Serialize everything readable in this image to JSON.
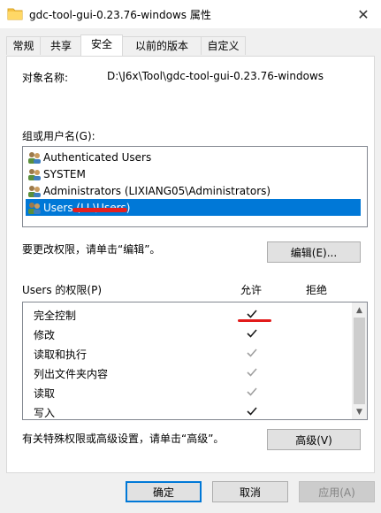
{
  "window": {
    "title": "gdc-tool-gui-0.23.76-windows 属性",
    "close_glyph": "✕"
  },
  "tabs": [
    {
      "label": "常规"
    },
    {
      "label": "共享"
    },
    {
      "label": "安全"
    },
    {
      "label": "以前的版本"
    },
    {
      "label": "自定义"
    }
  ],
  "active_tab": "安全",
  "object": {
    "label": "对象名称:",
    "value": "D:\\J6x\\Tool\\gdc-tool-gui-0.23.76-windows"
  },
  "groups": {
    "label": "组或用户名(G):",
    "items": [
      {
        "text": "Authenticated Users",
        "selected": false
      },
      {
        "text": "SYSTEM",
        "selected": false
      },
      {
        "text": "Administrators (LIXIANG05\\Administrators)",
        "selected": false
      },
      {
        "text": "Users (LI                \\Users)",
        "selected": true
      }
    ]
  },
  "edit": {
    "hint": "要更改权限，请单击“编辑”。",
    "button": "编辑(E)..."
  },
  "permissions": {
    "label": "Users 的权限(P)",
    "allow_header": "允许",
    "deny_header": "拒绝",
    "rows": [
      {
        "name": "完全控制",
        "allow": "dark",
        "deny": "none"
      },
      {
        "name": "修改",
        "allow": "dark",
        "deny": "none"
      },
      {
        "name": "读取和执行",
        "allow": "grey",
        "deny": "none"
      },
      {
        "name": "列出文件夹内容",
        "allow": "grey",
        "deny": "none"
      },
      {
        "name": "读取",
        "allow": "grey",
        "deny": "none"
      },
      {
        "name": "写入",
        "allow": "dark",
        "deny": "none"
      }
    ]
  },
  "advanced": {
    "hint": "有关特殊权限或高级设置，请单击“高级”。",
    "button": "高级(V)"
  },
  "footer": {
    "ok": "确定",
    "cancel": "取消",
    "apply": "应用(A)"
  },
  "colors": {
    "selection": "#0078d7",
    "annotation_red": "#e21b1b",
    "check_dark": "#1a1a1a",
    "check_grey": "#a0a0a0"
  }
}
